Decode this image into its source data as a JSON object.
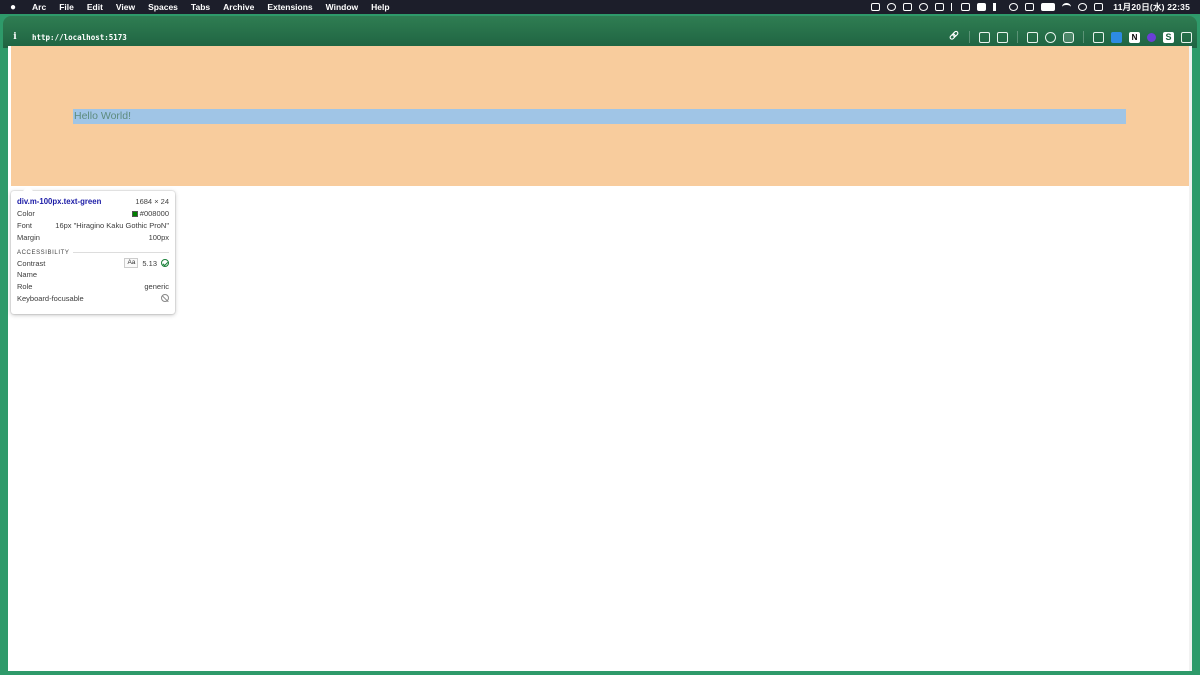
{
  "menubar": {
    "app_name": "Arc",
    "items": [
      "File",
      "Edit",
      "View",
      "Spaces",
      "Tabs",
      "Archive",
      "Extensions",
      "Window",
      "Help"
    ],
    "clock": "11月20日(水) 22:35",
    "tray_icons": [
      "creative-cloud-icon",
      "drop-icon",
      "notion-icon",
      "play-icon",
      "screen-icon",
      "arrows-icon",
      "display-icon",
      "keyboard-icon",
      "volume-icon",
      "user-icon",
      "input-icon",
      "battery-icon",
      "wifi-icon",
      "search-icon",
      "control-center-icon"
    ]
  },
  "toolbar": {
    "url": "http://localhost:5173",
    "info_icon": "i"
  },
  "page": {
    "text": "Hello World!"
  },
  "inspector": {
    "selector": "div.m-100px.text-green",
    "size": "1684 × 24",
    "color_label": "Color",
    "color_value": "#008000",
    "font_label": "Font",
    "font_value": "16px \"Hiragino Kaku Gothic ProN\"",
    "margin_label": "Margin",
    "margin_value": "100px",
    "accessibility_heading": "ACCESSIBILITY",
    "contrast_label": "Contrast",
    "contrast_badge": "Aa",
    "contrast_value": "5.13",
    "name_label": "Name",
    "name_value": "",
    "role_label": "Role",
    "role_value": "generic",
    "keyboard_label": "Keyboard-focusable"
  },
  "colors": {
    "frame": "#2e9a6a",
    "margin_overlay": "#f8cc9d",
    "content_overlay": "#a0c5e6",
    "text_green": "#008000"
  }
}
